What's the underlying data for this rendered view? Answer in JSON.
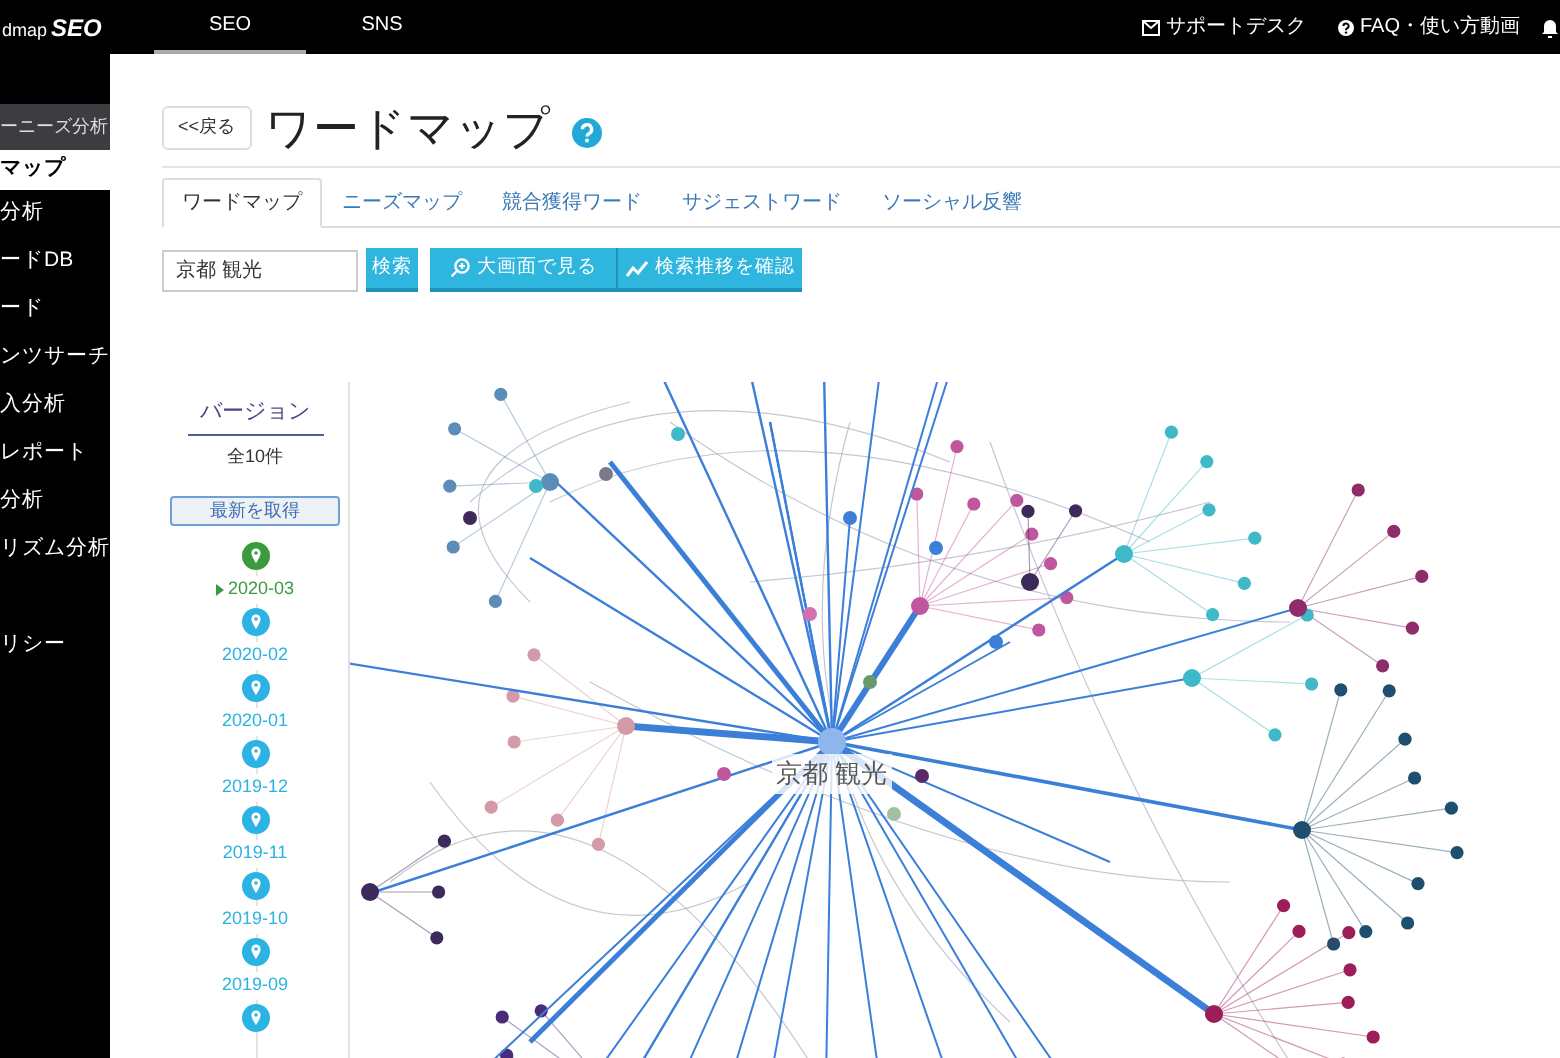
{
  "app": {
    "logo_prefix": "dmap",
    "logo_suffix": "SEO"
  },
  "top_nav": [
    {
      "label": "SEO",
      "selected": true
    },
    {
      "label": "SNS",
      "selected": false
    }
  ],
  "header_links": [
    {
      "label": "サポートデスク"
    },
    {
      "label": "FAQ・使い方動画"
    }
  ],
  "sidebar": {
    "section": "ーニーズ分析",
    "items": [
      {
        "label": "マップ",
        "selected": true
      },
      {
        "label": "分析",
        "selected": false
      },
      {
        "label": "ードDB",
        "selected": false
      },
      {
        "label": "ード",
        "selected": false
      },
      {
        "label": "ンツサーチ",
        "selected": false
      },
      {
        "label": "入分析",
        "selected": false
      },
      {
        "label": "レポート",
        "selected": false
      },
      {
        "label": "分析",
        "selected": false
      },
      {
        "label": "リズム分析",
        "selected": false
      },
      {
        "label": "リシー",
        "selected": false
      }
    ]
  },
  "page": {
    "back": "<<戻る",
    "title": "ワードマップ"
  },
  "tabs": [
    {
      "label": "ワードマップ",
      "selected": true
    },
    {
      "label": "ニーズマップ",
      "selected": false
    },
    {
      "label": "競合獲得ワード",
      "selected": false
    },
    {
      "label": "サジェストワード",
      "selected": false
    },
    {
      "label": "ソーシャル反響",
      "selected": false
    }
  ],
  "search": {
    "value": "京都 観光",
    "button": "検索"
  },
  "actions": [
    "大画面で見る",
    "検索推移を確認"
  ],
  "versions": {
    "title": "バージョン",
    "count": "全10件",
    "refresh": "最新を取得",
    "items": [
      {
        "date": "2020-03",
        "selected": true
      },
      {
        "date": "2020-02",
        "selected": false
      },
      {
        "date": "2020-01",
        "selected": false
      },
      {
        "date": "2019-12",
        "selected": false
      },
      {
        "date": "2019-11",
        "selected": false
      },
      {
        "date": "2019-10",
        "selected": false
      },
      {
        "date": "2019-09",
        "selected": false
      },
      {
        "selected": false
      }
    ]
  },
  "word_map": {
    "center": "京都 観光"
  }
}
